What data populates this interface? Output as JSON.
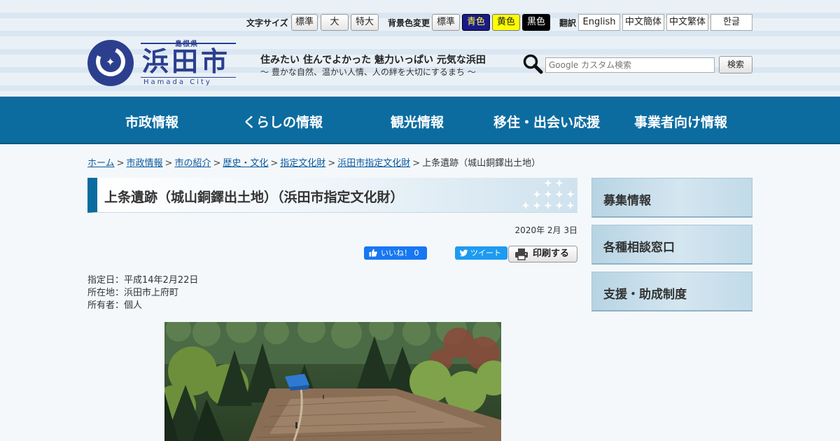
{
  "utility": {
    "font_size_label": "文字サイズ",
    "font_size_buttons": [
      "標準",
      "大",
      "特大"
    ],
    "bg_color_label": "背景色変更",
    "bg_color_buttons": [
      "標準",
      "青色",
      "黄色",
      "黒色"
    ],
    "translate_label": "翻訳",
    "language_buttons": [
      "English",
      "中文簡体",
      "中文繁体",
      "한글"
    ]
  },
  "logo": {
    "prefecture": "島根県",
    "city": "浜田市",
    "roman": "Hamada City"
  },
  "catchphrase": {
    "line1": "住みたい 住んでよかった 魅力いっぱい 元気な浜田",
    "line2": "～ 豊かな自然、温かい人情、人の絆を大切にするまち ～"
  },
  "search": {
    "placeholder": "Google カスタム検索",
    "button_label": "検索"
  },
  "nav": [
    "市政情報",
    "くらしの情報",
    "観光情報",
    "移住・出会い応援",
    "事業者向け情報"
  ],
  "breadcrumb": {
    "links": [
      "ホーム",
      "市政情報",
      "市の紹介",
      "歴史・文化",
      "指定文化財",
      "浜田市指定文化財"
    ],
    "current": "上条遺跡（城山銅鐸出土地）"
  },
  "page": {
    "title": "上条遺跡（城山銅鐸出土地）（浜田市指定文化財）",
    "date": "2020年 2月 3日",
    "facebook_label": "いいね！ 0",
    "tweet_label": "ツイート",
    "print_label": "印刷する",
    "info_lines": [
      "指定日：平成14年2月22日",
      "所在地：浜田市上府町",
      "所有者：個人"
    ]
  },
  "sidebar": [
    "募集情報",
    "各種相談窓口",
    "支援・助成制度"
  ],
  "colors": {
    "nav_bg": "#0c6ca0",
    "logo_blue": "#2c3f8f",
    "link": "#0c5a9e"
  }
}
